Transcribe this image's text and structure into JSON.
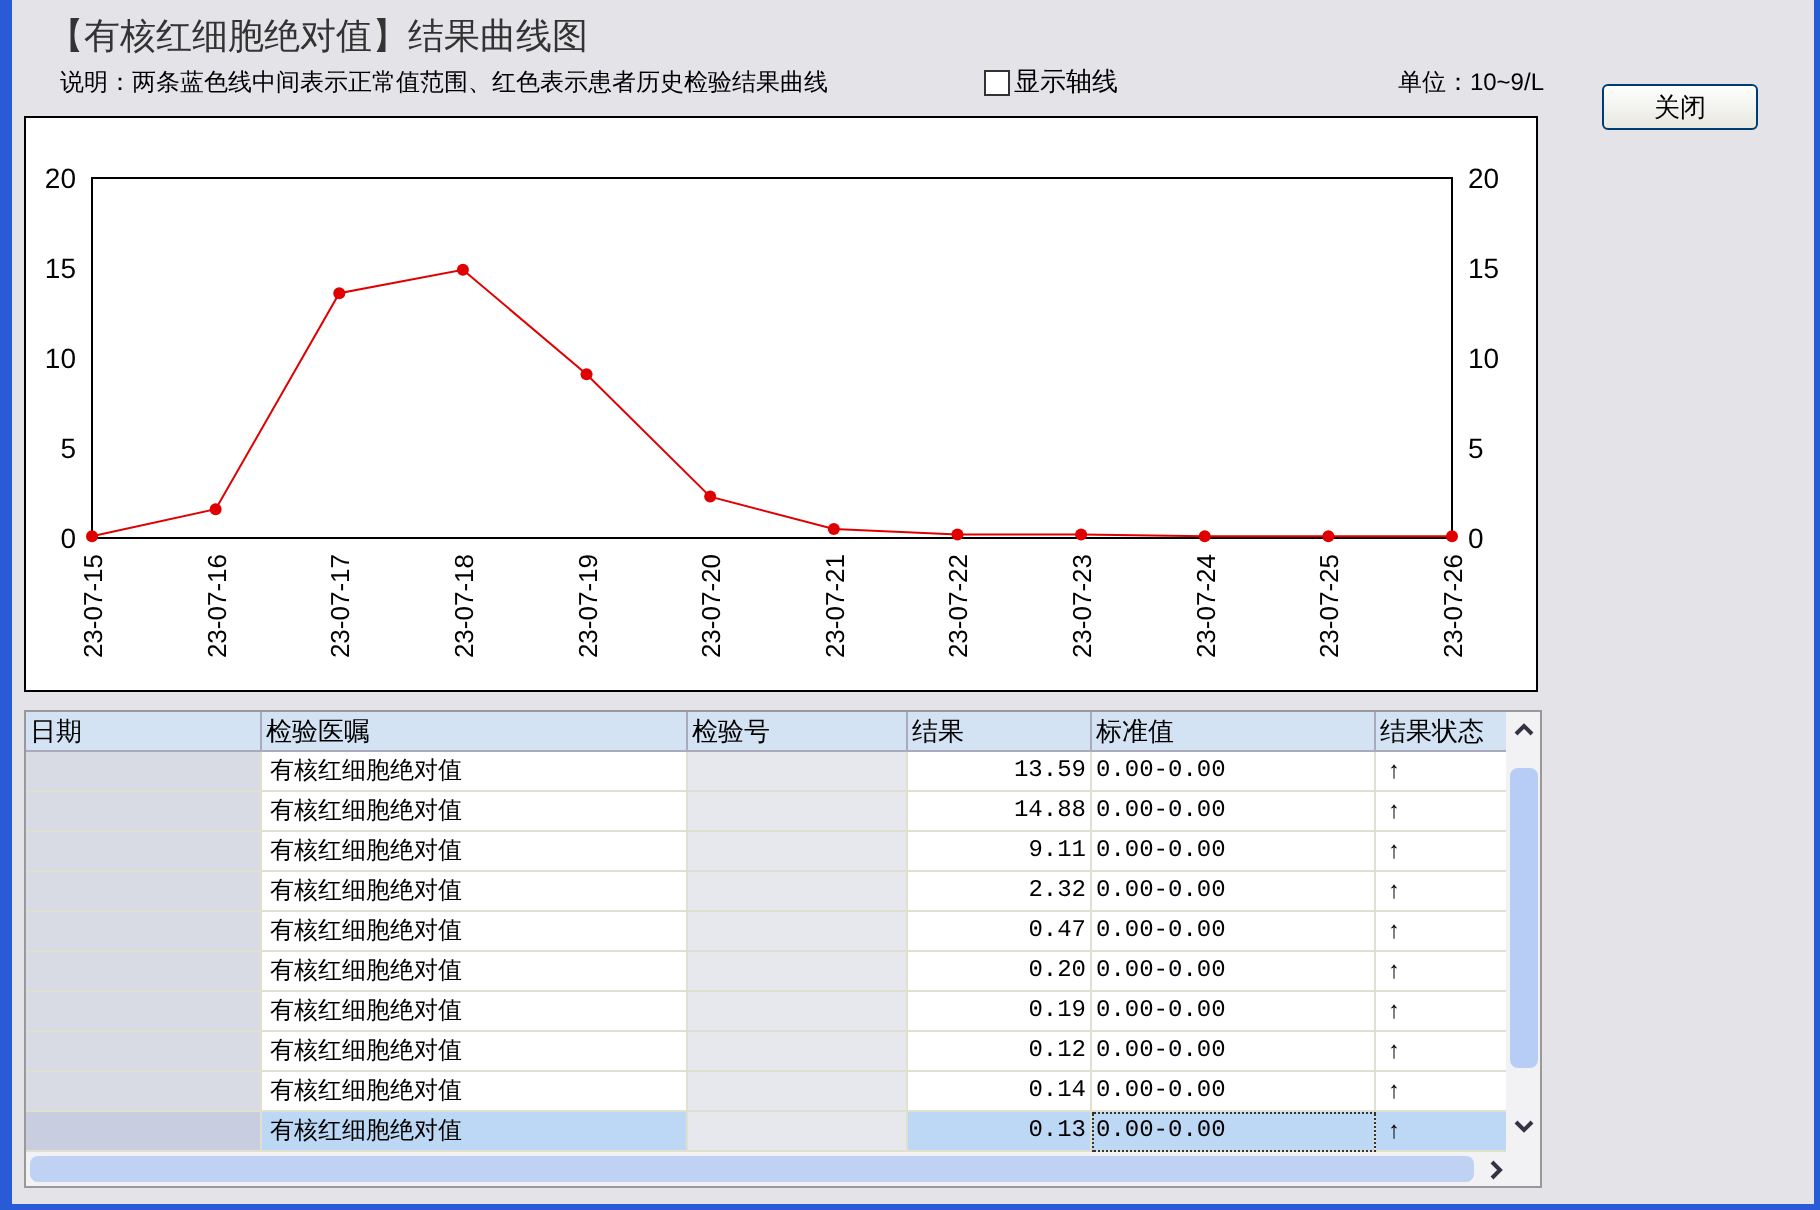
{
  "window": {
    "title": "【有核红细胞绝对值】结果曲线图"
  },
  "description": "说明：两条蓝色线中间表示正常值范围、红色表示患者历史检验结果曲线",
  "axis_checkbox": {
    "label": "显示轴线",
    "checked": false
  },
  "unit": "单位：10~9/L",
  "close_button": "关闭",
  "chart": {
    "chart_data": {
      "type": "line",
      "categories": [
        "23-07-15",
        "23-07-16",
        "23-07-17",
        "23-07-18",
        "23-07-19",
        "23-07-20",
        "23-07-21",
        "23-07-22",
        "23-07-23",
        "23-07-24",
        "23-07-25",
        "23-07-26"
      ],
      "series": [
        {
          "color": "#e00000",
          "marker": "circle",
          "values": [
            0.1,
            1.6,
            13.6,
            14.9,
            9.1,
            2.3,
            0.5,
            0.2,
            0.2,
            0.1,
            0.1,
            0.1
          ]
        }
      ],
      "ylim": [
        0,
        20
      ],
      "yticks": [
        0,
        5,
        10,
        15,
        20
      ]
    },
    "right_axis_labels": [
      "20",
      "15",
      "10",
      "5",
      "0"
    ]
  },
  "table": {
    "columns": [
      "日期",
      "检验医嘱",
      "检验号",
      "结果",
      "标准值",
      "结果状态"
    ],
    "rows": [
      {
        "order": "有核红细胞绝对值",
        "result": "13.59",
        "standard": "0.00-0.00",
        "status": "↑",
        "selected": false
      },
      {
        "order": "有核红细胞绝对值",
        "result": "14.88",
        "standard": "0.00-0.00",
        "status": "↑",
        "selected": false
      },
      {
        "order": "有核红细胞绝对值",
        "result": "9.11",
        "standard": "0.00-0.00",
        "status": "↑",
        "selected": false
      },
      {
        "order": "有核红细胞绝对值",
        "result": "2.32",
        "standard": "0.00-0.00",
        "status": "↑",
        "selected": false
      },
      {
        "order": "有核红细胞绝对值",
        "result": "0.47",
        "standard": "0.00-0.00",
        "status": "↑",
        "selected": false
      },
      {
        "order": "有核红细胞绝对值",
        "result": "0.20",
        "standard": "0.00-0.00",
        "status": "↑",
        "selected": false
      },
      {
        "order": "有核红细胞绝对值",
        "result": "0.19",
        "standard": "0.00-0.00",
        "status": "↑",
        "selected": false
      },
      {
        "order": "有核红细胞绝对值",
        "result": "0.12",
        "standard": "0.00-0.00",
        "status": "↑",
        "selected": false
      },
      {
        "order": "有核红细胞绝对值",
        "result": "0.14",
        "standard": "0.00-0.00",
        "status": "↑",
        "selected": false
      },
      {
        "order": "有核红细胞绝对值",
        "result": "0.13",
        "standard": "0.00-0.00",
        "status": "↑",
        "selected": true
      }
    ]
  }
}
